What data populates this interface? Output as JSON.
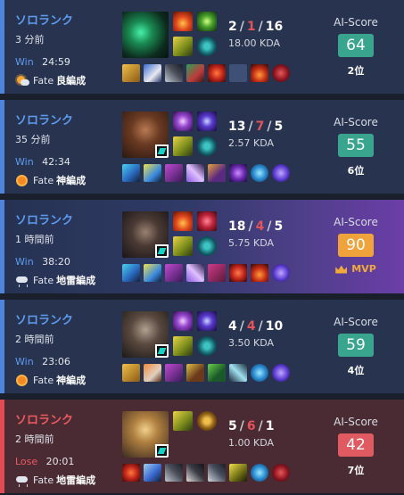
{
  "matches": [
    {
      "queue": "ソロランク",
      "ago": "3 分前",
      "result": "Win",
      "duration": "24:59",
      "weather_icon": "sun-cloud-icon",
      "fate": "Fate",
      "weather_label": "良編成",
      "kills": "2",
      "deaths": "1",
      "assists": "16",
      "kda_ratio": "18.00 KDA",
      "ai_label": "AI-Score",
      "score": "64",
      "score_color": "#3aa58f",
      "rank": "2位",
      "champion_icon": "champion-portrait-icon",
      "spells": [
        "ignite-icon",
        "smite-icon",
        "rune-primary-icon",
        "rune-secondary-icon"
      ],
      "items": [
        "item-1-icon",
        "item-2-icon",
        "item-3-icon",
        "item-4-icon",
        "item-5-icon",
        "empty-slot",
        "item-7-icon",
        "item-8-icon"
      ]
    },
    {
      "queue": "ソロランク",
      "ago": "35 分前",
      "result": "Win",
      "duration": "42:34",
      "weather_icon": "sun-icon",
      "fate": "Fate",
      "weather_label": "神編成",
      "kills": "13",
      "deaths": "7",
      "assists": "5",
      "kda_ratio": "2.57 KDA",
      "ai_label": "AI-Score",
      "score": "55",
      "score_color": "#3aa58f",
      "rank": "6位",
      "champion_icon": "champion-portrait-icon",
      "spells": [
        "ghost-icon",
        "teleport-icon",
        "rune-primary-icon",
        "rune-secondary-icon"
      ],
      "items": [
        "item-1-icon",
        "item-2-icon",
        "item-3-icon",
        "item-4-icon",
        "item-5-icon",
        "item-6-icon",
        "item-7-icon",
        "item-8-icon"
      ]
    },
    {
      "queue": "ソロランク",
      "ago": "1 時間前",
      "result": "Win",
      "duration": "38:20",
      "weather_icon": "storm-cloud-icon",
      "fate": "Fate",
      "weather_label": "地雷編成",
      "kills": "18",
      "deaths": "4",
      "assists": "5",
      "kda_ratio": "5.75 KDA",
      "ai_label": "AI-Score",
      "score": "90",
      "score_color": "#f0a33a",
      "mvp": "MVP",
      "champion_icon": "champion-portrait-icon",
      "spells": [
        "ignite-icon",
        "heal-icon",
        "rune-primary-icon",
        "rune-secondary-icon"
      ],
      "items": [
        "item-1-icon",
        "item-2-icon",
        "item-3-icon",
        "item-4-icon",
        "item-5-icon",
        "item-6-icon",
        "item-7-icon",
        "item-8-icon"
      ]
    },
    {
      "queue": "ソロランク",
      "ago": "2 時間前",
      "result": "Win",
      "duration": "23:06",
      "weather_icon": "sun-icon",
      "fate": "Fate",
      "weather_label": "神編成",
      "kills": "4",
      "deaths": "4",
      "assists": "10",
      "kda_ratio": "3.50 KDA",
      "ai_label": "AI-Score",
      "score": "59",
      "score_color": "#3aa58f",
      "rank": "4位",
      "champion_icon": "champion-portrait-icon",
      "spells": [
        "ghost-icon",
        "teleport-icon",
        "rune-primary-icon",
        "rune-secondary-icon"
      ],
      "items": [
        "item-1-icon",
        "item-2-icon",
        "item-3-icon",
        "item-4-icon",
        "item-5-icon",
        "item-6-icon",
        "item-7-icon",
        "item-8-icon"
      ]
    },
    {
      "queue": "ソロランク",
      "ago": "2 時間前",
      "result": "Lose",
      "duration": "20:01",
      "weather_icon": "storm-cloud-icon",
      "fate": "Fate",
      "weather_label": "地雷編成",
      "kills": "5",
      "deaths": "6",
      "assists": "1",
      "kda_ratio": "1.00 KDA",
      "ai_label": "AI-Score",
      "score": "42",
      "score_color": "#e05a62",
      "rank": "7位",
      "champion_icon": "champion-portrait-icon",
      "spells": [
        "rune-primary-icon",
        "rune-secondary-icon"
      ],
      "items": [
        "item-1-icon",
        "item-2-icon",
        "item-3-icon",
        "item-4-icon",
        "item-5-icon",
        "item-6-icon",
        "item-7-icon",
        "item-8-icon"
      ]
    }
  ]
}
